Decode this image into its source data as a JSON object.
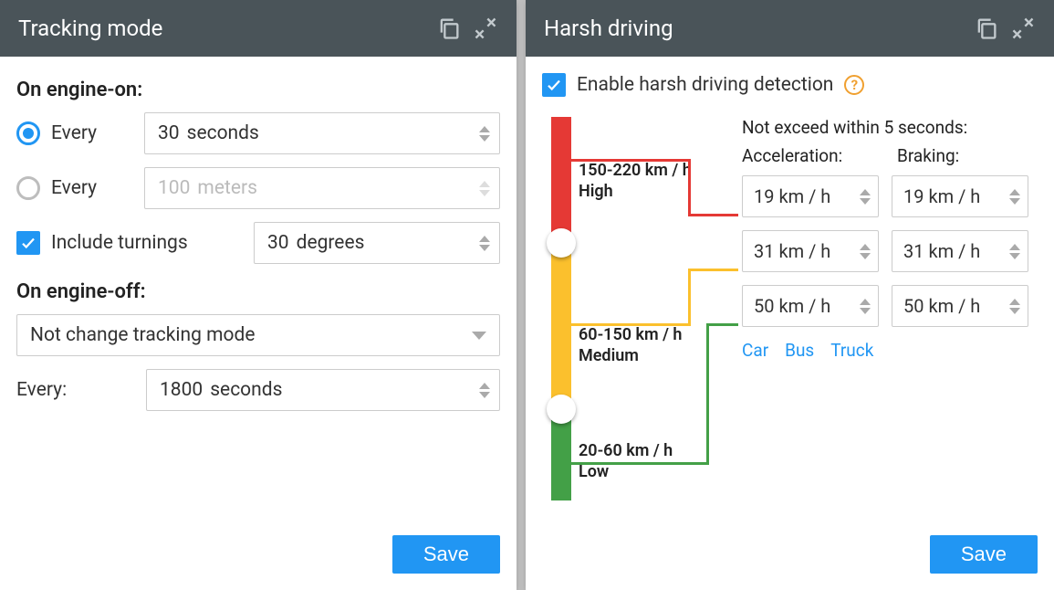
{
  "tracking": {
    "title": "Tracking mode",
    "engine_on_label": "On engine-on:",
    "every_label": "Every",
    "interval_seconds": {
      "value": "30",
      "unit": "seconds"
    },
    "interval_meters": {
      "value": "100",
      "unit": "meters"
    },
    "include_turnings_label": "Include turnings",
    "turnings_deg": {
      "value": "30",
      "unit": "degrees"
    },
    "engine_off_label": "On engine-off:",
    "engine_off_mode": "Not change tracking mode",
    "every_off_label": "Every:",
    "off_seconds": {
      "value": "1800",
      "unit": "seconds"
    },
    "save_label": "Save"
  },
  "harsh": {
    "title": "Harsh driving",
    "enable_label": "Enable harsh driving detection",
    "header_note": "Not exceed within 5 seconds:",
    "col_accel": "Acceleration:",
    "col_brake": "Braking:",
    "ranges": {
      "high": {
        "label": "150-220 km / h",
        "name": "High"
      },
      "medium": {
        "label": "60-150 km / h",
        "name": "Medium"
      },
      "low": {
        "label": "20-60 km / h",
        "name": "Low"
      }
    },
    "rows": [
      {
        "accel": "19",
        "brake": "19",
        "unit": "km / h"
      },
      {
        "accel": "31",
        "brake": "31",
        "unit": "km / h"
      },
      {
        "accel": "50",
        "brake": "50",
        "unit": "km / h"
      }
    ],
    "presets": {
      "car": "Car",
      "bus": "Bus",
      "truck": "Truck"
    },
    "save_label": "Save"
  }
}
